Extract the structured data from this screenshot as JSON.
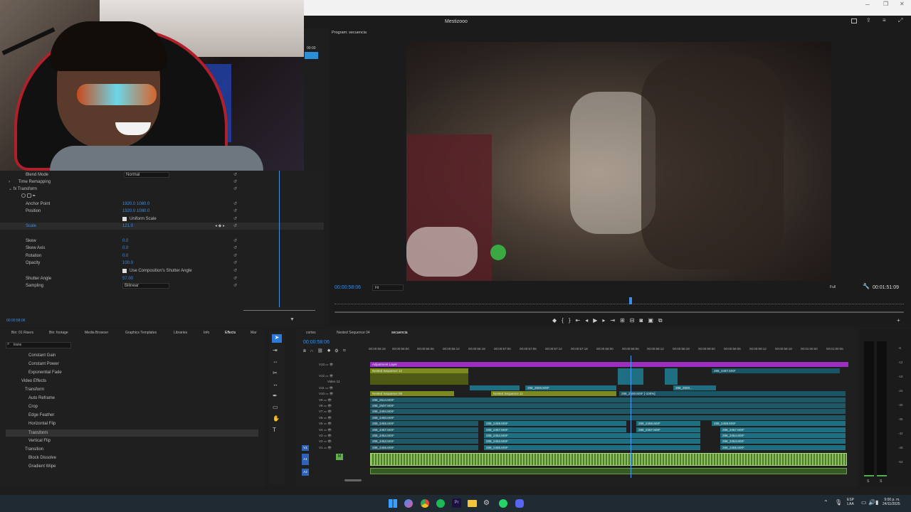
{
  "window": {
    "title": "Mestizooo"
  },
  "program_monitor": {
    "title": "Program: secuencia",
    "timecode": "00:00:58:06",
    "fit": "Fit",
    "quality": "Full",
    "duration": "00:01:51:09"
  },
  "source_panel": {
    "time": "00:00"
  },
  "effect_controls": {
    "props": [
      {
        "label": "Blend Mode",
        "value": "Normal"
      },
      {
        "label": "Time Remapping",
        "value": ""
      },
      {
        "label": "Transform",
        "value": ""
      },
      {
        "label": "Anchor Point",
        "value": "1920.0   1080.0"
      },
      {
        "label": "Position",
        "value": "1920.0   1080.0"
      },
      {
        "label": "Uniform Scale",
        "value": ""
      },
      {
        "label": "Scale",
        "value": "121.0"
      },
      {
        "label": "Skew",
        "value": "0.0"
      },
      {
        "label": "Skew Axis",
        "value": "0.0"
      },
      {
        "label": "Rotation",
        "value": "0.0"
      },
      {
        "label": "Opacity",
        "value": "100.0"
      },
      {
        "label": "Use Composition's Shutter Angle",
        "value": ""
      },
      {
        "label": "Shutter Angle",
        "value": "57.00"
      },
      {
        "label": "Sampling",
        "value": "Bilinear"
      }
    ],
    "timecode": "00:00:58:06"
  },
  "effects_panel": {
    "tabs": [
      "Bin: 01 Risers",
      "Bin: footage",
      "Media Browser",
      "Graphics Templates",
      "Libraries",
      "Info",
      "Effects",
      "Mar"
    ],
    "search": "trans",
    "items": [
      "Constant Gain",
      "Constant Power",
      "Exponential Fade",
      "Video Effects",
      "Transform",
      "Auto Reframe",
      "Crop",
      "Edge Feather",
      "Horizontal Flip",
      "Transform",
      "Vertical Flip",
      "Transition",
      "Block Dissolve",
      "Gradient Wipe"
    ]
  },
  "timeline": {
    "tabs": [
      "cortes",
      "Nested Sequence 04",
      "secuencia"
    ],
    "timecode": "00:00:58:06",
    "ruler": [
      "00:00:55:18",
      "00:00:56:00",
      "00:00:56:06",
      "00:00:56:12",
      "00:00:56:18",
      "00:00:57:00",
      "00:00:57:06",
      "00:00:57:12",
      "00:00:57:18",
      "00:00:58:00",
      "00:00:58:06",
      "00:00:58:12",
      "00:00:58:18",
      "00:00:59:00",
      "00:00:59:06",
      "00:00:59:12",
      "00:00:59:18",
      "00:01:00:00",
      "00:01:00:06"
    ],
    "tracks": [
      "V13",
      "V12",
      "Video 12",
      "V11",
      "V10",
      "V9",
      "V8",
      "V7",
      "V6",
      "V5",
      "V4",
      "V3",
      "V2",
      "V1",
      "A1",
      "A2"
    ],
    "clips": {
      "adj": "Adjustment Layer",
      "ns12": "Nested Sequence 12",
      "ns08": "Nested Sequence 08",
      "ns11": "Nested Sequence 11",
      "c2500": "288_2500.MXF",
      "c2500b": "288_2500.MXF [-100%]",
      "c2514": "288_2514.MXF",
      "c2507": "288_2507.MXF",
      "c2494": "288_2494.MXF",
      "c2450": "288_2450.MXF",
      "c2456": "288_2456.MXF",
      "c2457": "288_2457.MXF",
      "c2454": "288_2454.MXF",
      "c2453": "288_2453.MXF",
      "c2458": "288_2458.MXF",
      "c2497": "288_2497.MXF",
      "c2500s": "288_2500...",
      "c2455": "288_2455.MXF"
    }
  },
  "meter": {
    "ticks": [
      "-6",
      "-12",
      "-18",
      "-24",
      "-30",
      "-36",
      "-42",
      "-48",
      "-54",
      "dB"
    ],
    "bottom": [
      "S",
      "S"
    ]
  },
  "taskbar": {
    "lang": "ESP",
    "layout": "LAA",
    "time": "9:00 p. m.",
    "date": "24/11/2025"
  },
  "colors": {
    "accent": "#2d8ceb",
    "adjustment": "#9a2fc2",
    "nested": "#7c8a20",
    "clip": "#1f6f82",
    "audio": "#8cc25a"
  }
}
